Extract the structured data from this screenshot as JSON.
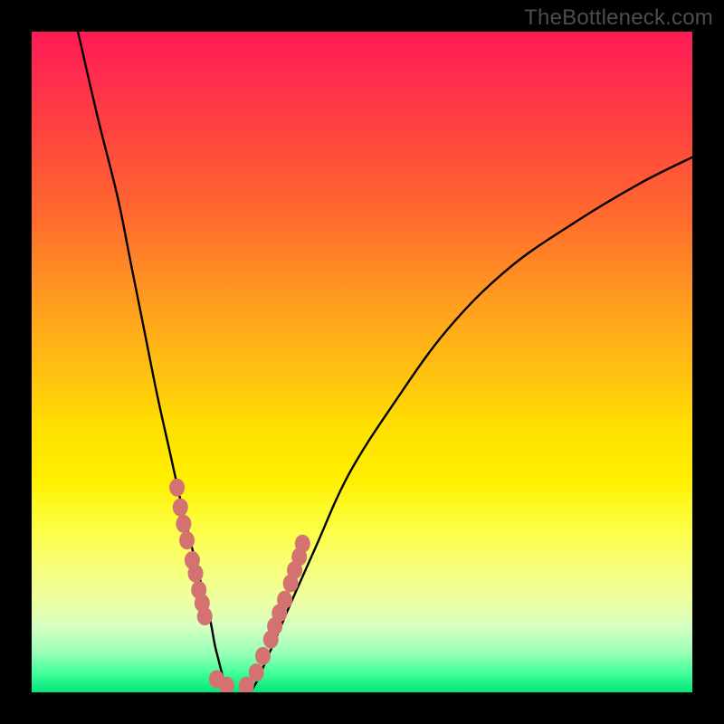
{
  "watermark": "TheBottleneck.com",
  "chart_data": {
    "type": "line",
    "title": "",
    "xlabel": "",
    "ylabel": "",
    "xlim": [
      0,
      100
    ],
    "ylim": [
      0,
      100
    ],
    "series": [
      {
        "name": "bottleneck-curve",
        "x": [
          7,
          10,
          13,
          15,
          17,
          19,
          21,
          23,
          25,
          27,
          28,
          30,
          33,
          36,
          39,
          43,
          48,
          55,
          63,
          72,
          82,
          92,
          100
        ],
        "y": [
          100,
          87,
          75,
          65,
          55,
          45,
          36,
          27,
          19,
          11,
          6,
          0,
          0,
          6,
          13,
          22,
          33,
          44,
          55,
          64,
          71,
          77,
          81
        ]
      },
      {
        "name": "marker-cluster",
        "type": "scatter",
        "x": [
          22,
          22.5,
          23,
          23.5,
          24.3,
          24.8,
          25.3,
          25.8,
          26.2,
          28,
          29.5,
          32.5,
          34,
          35,
          36.2,
          36.8,
          37.5,
          38.3,
          39.2,
          39.8,
          40.5,
          41
        ],
        "y": [
          31,
          28,
          25.5,
          23,
          20,
          18,
          15.5,
          13.5,
          11.5,
          2,
          1,
          1,
          3,
          5.5,
          8,
          10,
          12,
          14,
          16.5,
          18.5,
          20.5,
          22.5
        ]
      }
    ],
    "colors": {
      "curve": "#000000",
      "markers": "#d47272",
      "background_top": "#ff1a55",
      "background_bottom": "#00e57a"
    }
  }
}
